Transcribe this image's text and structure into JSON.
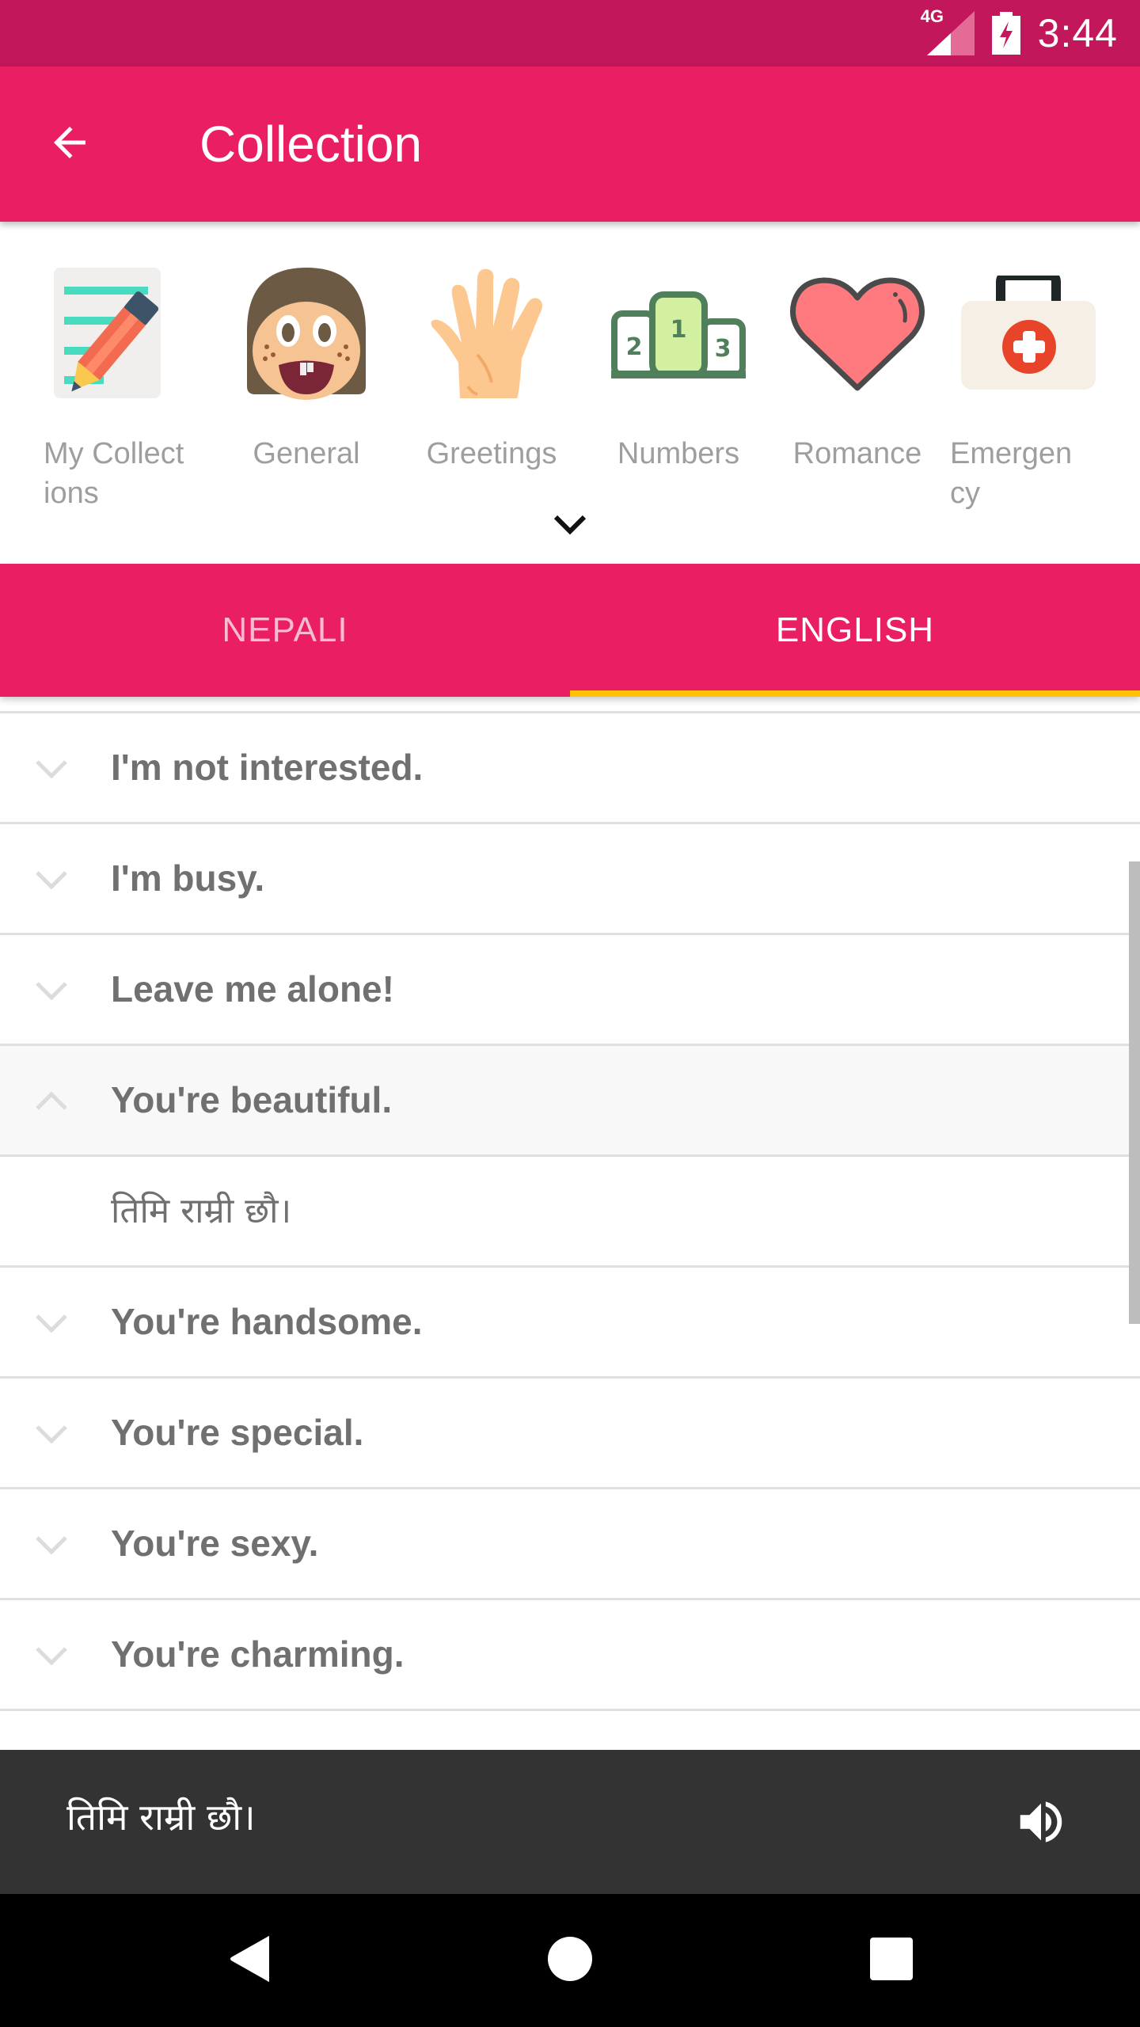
{
  "status_bar": {
    "network": "4G",
    "time": "3:44",
    "icons": [
      "signal-icon",
      "battery-charging-icon"
    ]
  },
  "toolbar": {
    "back_icon": "arrow-left-icon",
    "title": "Collection"
  },
  "categories": [
    {
      "label": "My Collect ions",
      "icon": "notepad-pencil-icon"
    },
    {
      "label": "General",
      "icon": "smiling-face-icon"
    },
    {
      "label": "Greetings",
      "icon": "waving-hand-icon"
    },
    {
      "label": "Numbers",
      "icon": "podium-icon"
    },
    {
      "label": "Romance",
      "icon": "heart-icon"
    },
    {
      "label": "Emergen cy",
      "icon": "first-aid-kit-icon"
    }
  ],
  "expand_icon": "chevron-down-icon",
  "tabs": [
    {
      "label": "NEPALI",
      "selected": false
    },
    {
      "label": "ENGLISH",
      "selected": true
    }
  ],
  "colors": {
    "primary": "#E91E63",
    "primary_dark": "#C2185B",
    "accent": "#FFC107",
    "bottom_bar": "#333333"
  },
  "phrases": [
    {
      "text": "I'm not interested.",
      "expanded": false
    },
    {
      "text": "I'm busy.",
      "expanded": false
    },
    {
      "text": "Leave me alone!",
      "expanded": false
    },
    {
      "text": "You're beautiful.",
      "expanded": true,
      "translation": "तिमि राम्री छौ।"
    },
    {
      "text": "You're handsome.",
      "expanded": false
    },
    {
      "text": "You're special.",
      "expanded": false
    },
    {
      "text": "You're sexy.",
      "expanded": false
    },
    {
      "text": "You're charming.",
      "expanded": false
    }
  ],
  "player": {
    "text": "तिमि राम्री छौ।",
    "icon": "speaker-icon"
  },
  "nav": {
    "back": "nav-back-icon",
    "home": "nav-home-icon",
    "recents": "nav-recents-icon"
  }
}
